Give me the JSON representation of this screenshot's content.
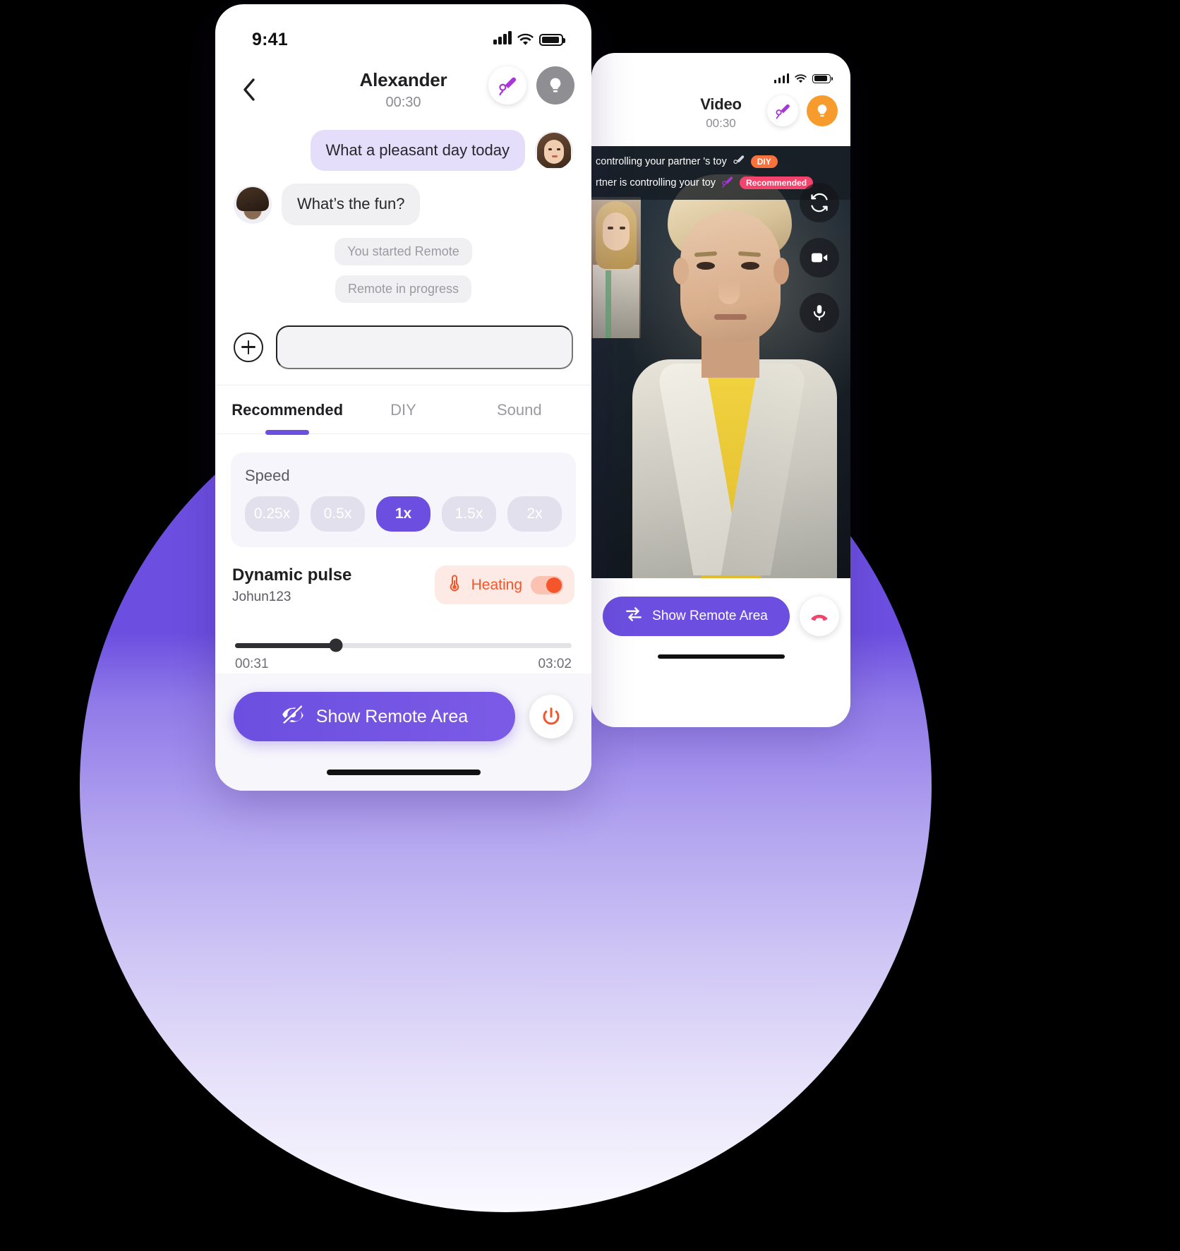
{
  "left_phone": {
    "status_bar": {
      "time": "9:41",
      "signal_icon": "cellular-bars-icon",
      "wifi_icon": "wifi-icon",
      "battery_icon": "battery-icon"
    },
    "header": {
      "back_icon": "chevron-left-icon",
      "contact_name": "Alexander",
      "call_timer": "00:30",
      "toy_icon": "vibrator-toy-icon",
      "bulb_icon": "lightbulb-icon"
    },
    "chat": {
      "messages": [
        {
          "side": "right",
          "text": "What a pleasant day today",
          "avatar": "female-avatar"
        },
        {
          "side": "left",
          "text": "What’s the fun?",
          "avatar": "male-avatar"
        }
      ],
      "system_messages": [
        "You started Remote",
        "Remote in progress"
      ]
    },
    "composer": {
      "add_icon": "plus-circle-icon",
      "input_value": "",
      "input_placeholder": ""
    },
    "tabs": [
      {
        "label": "Recommended",
        "active": true
      },
      {
        "label": "DIY",
        "active": false
      },
      {
        "label": "Sound",
        "active": false
      }
    ],
    "speed": {
      "label": "Speed",
      "options": [
        "0.25x",
        "0.5x",
        "1x",
        "1.5x",
        "2x"
      ],
      "selected": "1x"
    },
    "pattern": {
      "title": "Dynamic pulse",
      "author": "Johun123",
      "heating": {
        "label": "Heating",
        "icon": "thermometer-icon",
        "enabled": true
      }
    },
    "progress": {
      "current": "00:31",
      "total": "03:02",
      "percent": 30
    },
    "player": {
      "shuffle_icon": "shuffle-icon",
      "prev_icon": "skip-previous-icon",
      "play_icon": "play-icon",
      "next_icon": "skip-next-icon",
      "queue_icon": "playlist-queue-icon"
    },
    "bottom": {
      "remote_label": "Show Remote Area",
      "remote_icon": "eye-off-icon",
      "power_icon": "power-icon"
    },
    "colors": {
      "accent": "#6C4FE0",
      "chip_off": "#E2E0EC",
      "heat": "#F5552A",
      "bubble_me": "#E4DEFB",
      "bubble_them": "#F0F0F2"
    }
  },
  "right_phone": {
    "status_bar": {
      "signal_icon": "cellular-bars-icon",
      "wifi_icon": "wifi-icon",
      "battery_icon": "battery-icon"
    },
    "header": {
      "title": "Video",
      "call_timer": "00:30",
      "toy_icon": "vibrator-toy-icon",
      "bulb_icon": "lightbulb-icon"
    },
    "banner": [
      {
        "text": "controlling your partner 's toy",
        "toy_icon": "toy-grey-icon",
        "tag": "DIY",
        "tag_color": "#F9713C"
      },
      {
        "text": "rtner is controlling your toy",
        "toy_icon": "vibrator-toy-icon",
        "tag": "Recommended",
        "tag_color": "#F4436C"
      }
    ],
    "video_controls": [
      {
        "name": "switch-camera-icon"
      },
      {
        "name": "video-camera-icon"
      },
      {
        "name": "microphone-icon"
      }
    ],
    "bottom": {
      "remote_label": "Show Remote Area",
      "remote_icon": "swap-arrows-icon",
      "hangup_icon": "phone-hangup-icon"
    },
    "colors": {
      "accent": "#6C4FE0",
      "bulb_bg": "#F79B2D",
      "hangup": "#F4436C"
    }
  },
  "background": {
    "blob_color": "#6C4FE0"
  }
}
